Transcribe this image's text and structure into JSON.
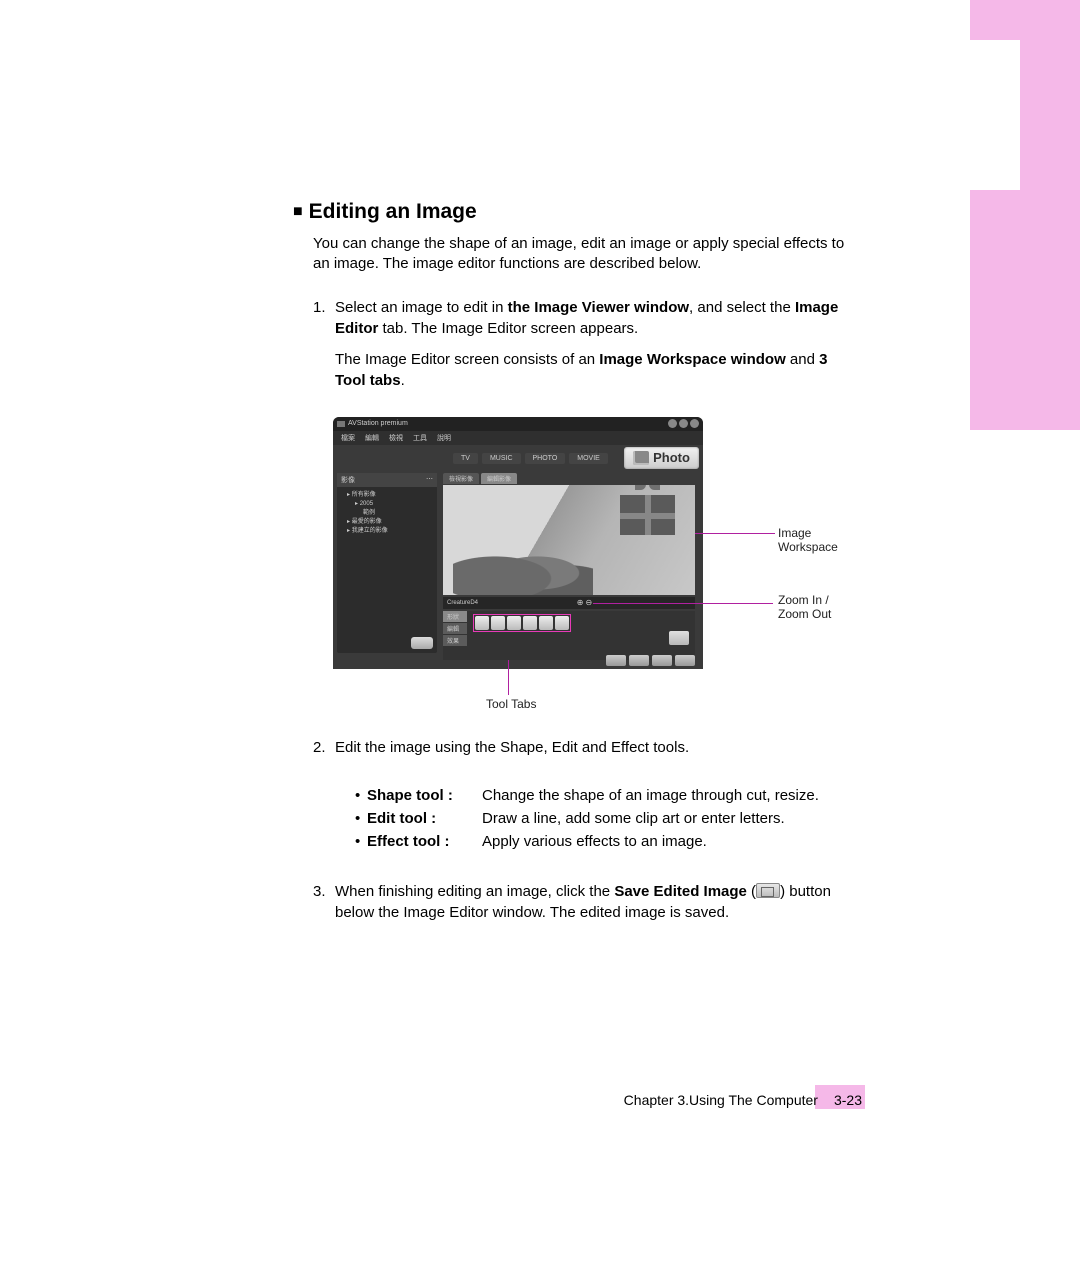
{
  "heading": "Editing an Image",
  "intro": "You can change the shape of an image, edit an image or apply special effects to an image. The image editor functions are described below.",
  "step1": {
    "num": "1.",
    "p1_a": "Select an image to edit in ",
    "p1_b": "the Image Viewer window",
    "p1_c": ", and select the ",
    "p1_d": "Image Editor",
    "p1_e": " tab. The Image Editor screen appears.",
    "p2_a": "The Image Editor screen consists of an ",
    "p2_b": "Image Workspace window",
    "p2_c": " and ",
    "p2_d": "3 Tool tabs",
    "p2_e": "."
  },
  "app": {
    "title": "AVStation premium",
    "menus": [
      "檔案",
      "編輯",
      "檢視",
      "工具",
      "說明"
    ],
    "photo_label": "Photo",
    "modes": [
      "TV",
      "MUSIC",
      "PHOTO",
      "MOVIE"
    ],
    "sidebar_header": "影像",
    "tree": [
      "所有影像",
      "2005",
      "範例",
      "最愛的影像",
      "我建立的影像"
    ],
    "subtabs": [
      "檢視影像",
      "編輯影像"
    ],
    "status_left": "CreatureD4",
    "status_right": "",
    "tool_tabs": [
      "形狀",
      "編輯",
      "效果"
    ]
  },
  "callouts": {
    "workspace": "Image Workspace",
    "zoom": "Zoom In / Zoom Out",
    "tooltabs": "Tool Tabs"
  },
  "step2": {
    "num": "2.",
    "text": "Edit the image using the Shape, Edit and Effect tools."
  },
  "tools": {
    "shape_name": "Shape tool :",
    "shape_desc": "Change the shape of an image through cut, resize.",
    "edit_name": "Edit tool :",
    "edit_desc": "Draw a line, add some clip art or enter letters.",
    "effect_name": "Effect tool :",
    "effect_desc": "Apply various effects to an image."
  },
  "step3": {
    "num": "3.",
    "a": "When finishing editing an image, click the ",
    "b": "Save Edited Image",
    "c": " (",
    "d": ") button below the Image Editor window. The edited image is saved."
  },
  "footer": {
    "chapter": "Chapter 3.Using The Computer",
    "page": "3-23"
  },
  "bullet": "•"
}
